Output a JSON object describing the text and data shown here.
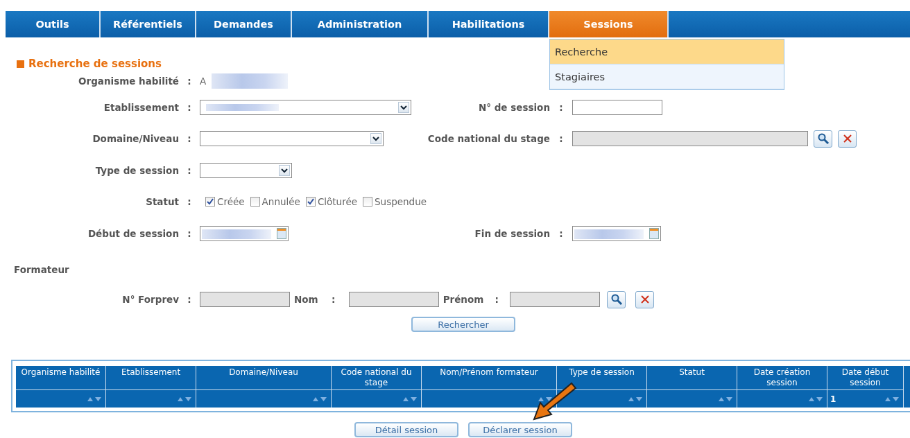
{
  "nav": {
    "tabs": [
      {
        "label": "Outils",
        "selected": false
      },
      {
        "label": "Référentiels",
        "selected": false
      },
      {
        "label": "Demandes",
        "selected": false
      },
      {
        "label": "Administration",
        "selected": false
      },
      {
        "label": "Habilitations",
        "selected": false
      },
      {
        "label": "Sessions",
        "selected": true
      }
    ]
  },
  "menu": {
    "items": [
      {
        "label": "Recherche",
        "selected": true
      },
      {
        "label": "Stagiaires",
        "selected": false
      }
    ]
  },
  "section_title": "Recherche de sessions",
  "rows": [
    {
      "fields": [
        {
          "label": "Organisme habilité",
          "colon": ":",
          "kind": "value",
          "value": "A"
        }
      ]
    },
    {
      "fields": [
        {
          "label": "Etablissement",
          "colon": ":",
          "kind": "select"
        },
        {
          "label": "N° de session",
          "colon": ":",
          "kind": "input"
        }
      ]
    },
    {
      "fields": [
        {
          "label": "Domaine/Niveau",
          "colon": ":",
          "kind": "select"
        },
        {
          "label": "Code national du stage",
          "colon": ":",
          "kind": "lookup"
        }
      ]
    },
    {
      "fields": [
        {
          "label": "Type de session",
          "colon": ":",
          "kind": "select"
        }
      ]
    },
    {
      "fields": [
        {
          "label": "Statut",
          "colon": ":",
          "kind": "checkboxes",
          "options": [
            {
              "label": "Créée",
              "checked": true
            },
            {
              "label": "Annulée",
              "checked": false
            },
            {
              "label": "Clôturée",
              "checked": true
            },
            {
              "label": "Suspendue",
              "checked": false
            }
          ]
        }
      ]
    },
    {
      "fields": [
        {
          "label": "Début de session",
          "colon": ":",
          "kind": "date"
        },
        {
          "label": "Fin de session",
          "colon": ":",
          "kind": "date"
        }
      ]
    }
  ],
  "formateur": {
    "title": "Formateur",
    "fields": [
      {
        "label": "N° Forprev",
        "colon": ":"
      },
      {
        "label": "Nom",
        "colon": ":"
      },
      {
        "label": "Prénom",
        "colon": ":"
      }
    ]
  },
  "search_button": "Rechercher",
  "table": {
    "columns": [
      "Organisme habilité",
      "Etablissement",
      "Domaine/Niveau",
      "Code national du stage",
      "Nom/Prénom formateur",
      "Type de session",
      "Statut",
      "Date création session",
      "Date début session"
    ],
    "last_column_filter": "1"
  },
  "buttons": [
    "Détail session",
    "Déclarer session"
  ]
}
